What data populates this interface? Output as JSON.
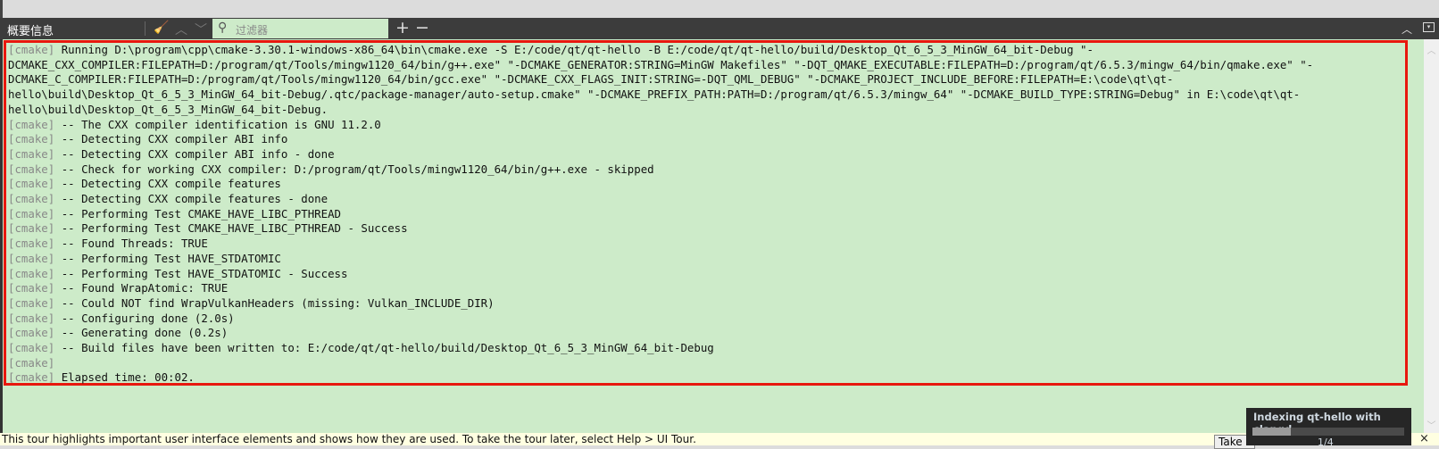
{
  "panel": {
    "title": "概要信息",
    "filter_placeholder": "过滤器",
    "icons": [
      "clear-icon",
      "arrow-up-icon",
      "arrow-down-icon",
      "search-icon",
      "plus-icon",
      "minus-icon",
      "maximize-icon",
      "close-panel-icon"
    ]
  },
  "log": {
    "tag": "[cmake]",
    "lines": [
      "Running D:\\program\\cpp\\cmake-3.30.1-windows-x86_64\\bin\\cmake.exe -S E:/code/qt/qt-hello -B E:/code/qt/qt-hello/build/Desktop_Qt_6_5_3_MinGW_64_bit-Debug \"-DCMAKE_CXX_COMPILER:FILEPATH=D:/program/qt/Tools/mingw1120_64/bin/g++.exe\" \"-DCMAKE_GENERATOR:STRING=MinGW Makefiles\" \"-DQT_QMAKE_EXECUTABLE:FILEPATH=D:/program/qt/6.5.3/mingw_64/bin/qmake.exe\" \"-DCMAKE_C_COMPILER:FILEPATH=D:/program/qt/Tools/mingw1120_64/bin/gcc.exe\" \"-DCMAKE_CXX_FLAGS_INIT:STRING=-DQT_QML_DEBUG\" \"-DCMAKE_PROJECT_INCLUDE_BEFORE:FILEPATH=E:\\code\\qt\\qt-hello\\build\\Desktop_Qt_6_5_3_MinGW_64_bit-Debug/.qtc/package-manager/auto-setup.cmake\" \"-DCMAKE_PREFIX_PATH:PATH=D:/program/qt/6.5.3/mingw_64\" \"-DCMAKE_BUILD_TYPE:STRING=Debug\" in E:\\code\\qt\\qt-hello\\build\\Desktop_Qt_6_5_3_MinGW_64_bit-Debug.",
      "-- The CXX compiler identification is GNU 11.2.0",
      "-- Detecting CXX compiler ABI info",
      "-- Detecting CXX compiler ABI info - done",
      "-- Check for working CXX compiler: D:/program/qt/Tools/mingw1120_64/bin/g++.exe - skipped",
      "-- Detecting CXX compile features",
      "-- Detecting CXX compile features - done",
      "-- Performing Test CMAKE_HAVE_LIBC_PTHREAD",
      "-- Performing Test CMAKE_HAVE_LIBC_PTHREAD - Success",
      "-- Found Threads: TRUE",
      "-- Performing Test HAVE_STDATOMIC",
      "-- Performing Test HAVE_STDATOMIC - Success",
      "-- Found WrapAtomic: TRUE",
      "-- Could NOT find WrapVulkanHeaders (missing: Vulkan_INCLUDE_DIR)",
      "-- Configuring done (2.0s)",
      "-- Generating done (0.2s)",
      "-- Build files have been written to: E:/code/qt/qt-hello/build/Desktop_Qt_6_5_3_MinGW_64_bit-Debug",
      "",
      "Elapsed time: 00:02."
    ]
  },
  "tour": {
    "text": "This tour highlights important user interface elements and shows how they are used. To take the tour later, select Help > UI Tour.",
    "take_button": "Take",
    "close": "×"
  },
  "indexing": {
    "title": "Indexing qt-hello with clangd",
    "progress": 0.25,
    "count": "1/4"
  },
  "colors": {
    "highlight": "#e8170e",
    "output_bg": "#cdebc9",
    "toolbar_bg": "#3c3c3c"
  }
}
